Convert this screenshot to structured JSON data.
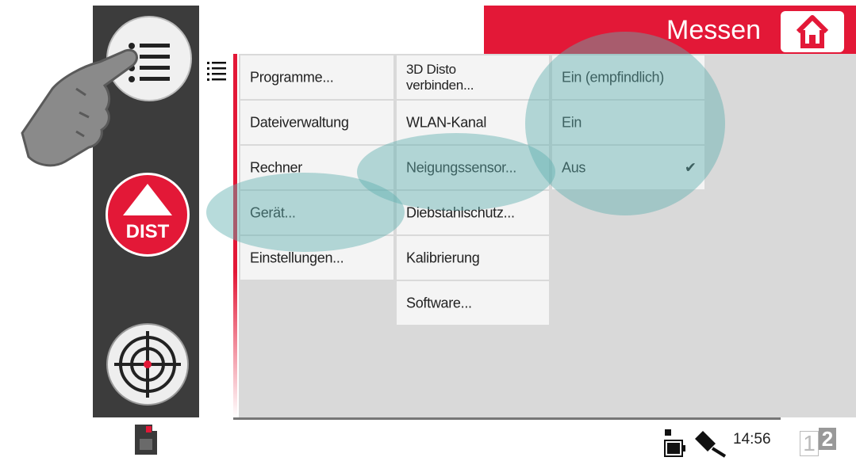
{
  "header": {
    "title": "Messen"
  },
  "menu": {
    "col1": [
      "Programme...",
      "Dateiverwaltung",
      "Rechner",
      "Gerät...",
      "Einstellungen..."
    ],
    "col2": [
      "3D Disto\nverbinden...",
      "WLAN-Kanal",
      "Neigungssensor...",
      "Diebstahlschutz...",
      "Kalibrierung",
      "Software..."
    ],
    "col3": [
      "Ein (empfindlich)",
      "Ein",
      "Aus"
    ],
    "col3_selected": "Aus",
    "checkmark": "✔"
  },
  "sidebar": {
    "dist_label": "DIST"
  },
  "status": {
    "time": "14:56",
    "page_1": "1",
    "page_2": "2"
  },
  "colors": {
    "brand_red": "#e31837",
    "highlight": "#5fafaf"
  }
}
